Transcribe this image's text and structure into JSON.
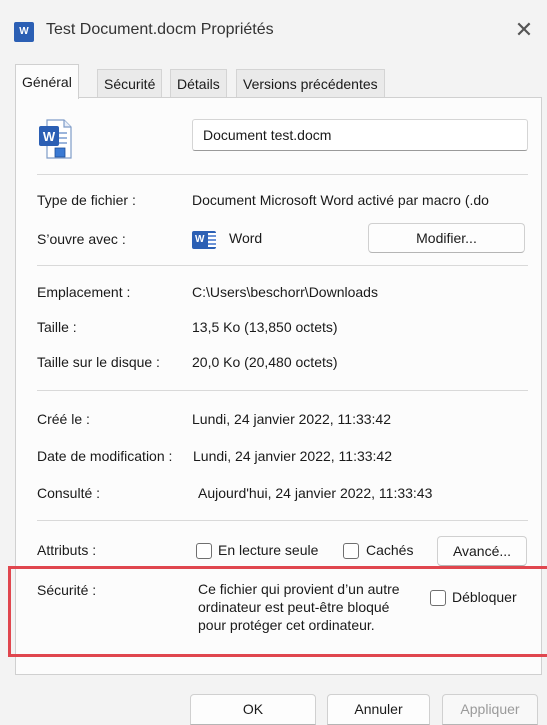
{
  "window": {
    "title": "Test Document.docm Propriétés",
    "close_glyph": "✕",
    "app_icon_letter": "W"
  },
  "tabs": [
    {
      "label": "Général",
      "active": true
    },
    {
      "label": "Sécurité",
      "active": false
    },
    {
      "label": "Détails",
      "active": false
    },
    {
      "label": "Versions précédentes",
      "active": false
    }
  ],
  "general": {
    "file_name": "Document test.docm",
    "file_type_label": "Type de fichier :",
    "file_type_value": "Document Microsoft Word activé par macro (.do",
    "opens_with_label": "S’ouvre avec :",
    "opens_with_value": "Word",
    "opens_with_icon_letter": "W",
    "change_button": "Modifier...",
    "location_label": "Emplacement :",
    "location_value": "C:\\Users\\beschorr\\Downloads",
    "size_label": "Taille :",
    "size_value": "13,5 Ko (13,850 octets)",
    "disk_size_label": "Taille sur le disque :",
    "disk_size_value": "20,0 Ko (20,480 octets)",
    "created_label": "Créé le :",
    "created_value": "Lundi, 24 janvier 2022, 11:33:42",
    "modified_label": "Date de modification :",
    "modified_value": "Lundi, 24 janvier 2022, 11:33:42",
    "accessed_label": "Consulté :",
    "accessed_value": "Aujourd'hui, 24 janvier 2022, 11:33:43",
    "attributes_label": "Attributs :",
    "readonly_label": "En lecture seule",
    "readonly_checked": false,
    "hidden_label": "Cachés",
    "hidden_checked": false,
    "advanced_button": "Avancé...",
    "security_label": "Sécurité :",
    "security_line1": "Ce fichier qui provient d’un autre",
    "security_line2": "ordinateur est peut-être bloqué",
    "security_line3": "pour protéger cet ordinateur.",
    "unblock_label": "Débloquer",
    "unblock_checked": false
  },
  "footer": {
    "ok_button": "OK",
    "cancel_button": "Annuler",
    "apply_button": "Appliquer",
    "apply_enabled": false
  },
  "colors": {
    "highlight": "#e0464e",
    "word_blue": "#2b5fb4"
  },
  "icons": {
    "app": "word-document-icon",
    "document": "word-macro-document-icon",
    "opens_with": "word-app-icon",
    "close": "close-icon"
  }
}
